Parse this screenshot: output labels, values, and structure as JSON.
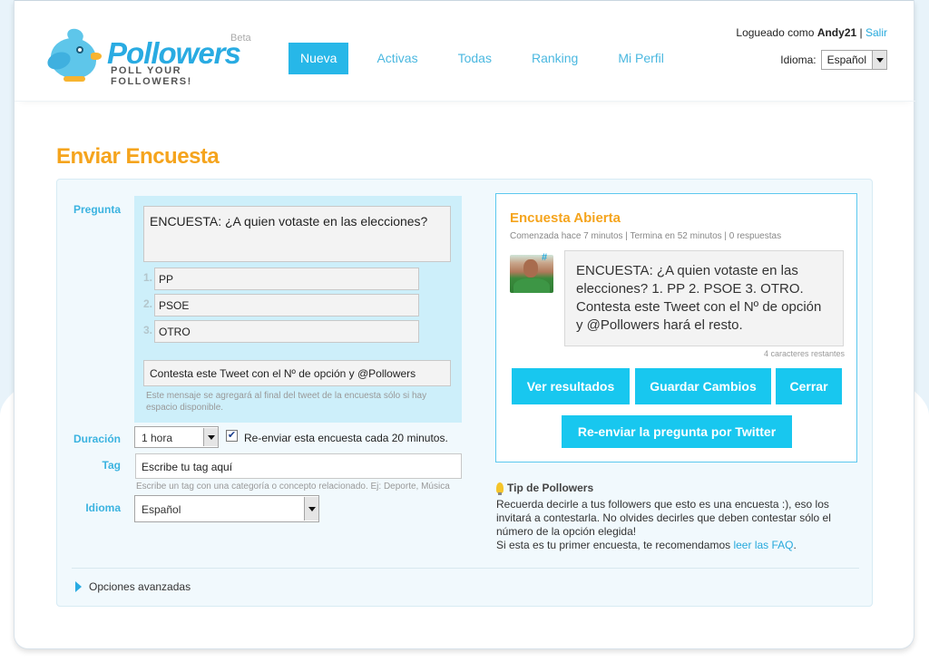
{
  "header": {
    "brand": "Pollowers",
    "beta": "Beta",
    "tagline": "POLL YOUR FOLLOWERS!",
    "nav": [
      {
        "label": "Nueva",
        "active": true
      },
      {
        "label": "Activas",
        "active": false
      },
      {
        "label": "Todas",
        "active": false
      },
      {
        "label": "Ranking",
        "active": false
      },
      {
        "label": "Mi Perfil",
        "active": false
      }
    ],
    "logged_prefix": "Logueado como",
    "username": "Andy21",
    "separator": "|",
    "logout": "Salir",
    "language_label": "Idioma:",
    "language_value": "Español"
  },
  "page_title": "Enviar Encuesta",
  "form": {
    "question_label": "Pregunta",
    "question": "ENCUESTA: ¿A quien votaste en las elecciones?",
    "options": [
      {
        "num": "1.",
        "value": "PP"
      },
      {
        "num": "2.",
        "value": "PSOE"
      },
      {
        "num": "3.",
        "value": "OTRO"
      }
    ],
    "suffix": "Contesta este Tweet con el Nº de opción y @Pollowers",
    "suffix_note": "Este mensaje se agregará al final del tweet de la encuesta sólo si hay espacio disponible.",
    "duration_label": "Duración",
    "duration_value": "1 hora",
    "resend_checked": true,
    "resend_label": "Re-enviar esta encuesta cada 20 minutos.",
    "tag_label": "Tag",
    "tag_value": "Escribe tu tag aquí",
    "tag_note": "Escribe un tag con una categoría o concepto relacionado. Ej: Deporte, Música",
    "language_label": "Idioma",
    "language_value": "Español",
    "advanced_label": "Opciones avanzadas"
  },
  "preview": {
    "title": "Encuesta Abierta",
    "meta": "Comenzada hace 7 minutos | Termina en 52 minutos | 0 respuestas",
    "hash_icon": "#",
    "tweet": "ENCUESTA: ¿A quien votaste en las elecciones? 1. PP 2. PSOE 3. OTRO. Contesta este Tweet con el Nº de opción y @Pollowers hará el resto.",
    "remaining": "4 caracteres restantes",
    "buttons": {
      "results": "Ver resultados",
      "save": "Guardar Cambios",
      "close": "Cerrar",
      "resend": "Re-enviar la pregunta por Twitter"
    }
  },
  "tip": {
    "title": "Tip de Pollowers",
    "body": "Recuerda decirle a tus followers que esto es una encuesta :), eso los invitará a contestarla. No olvides decirles que deben contestar sólo el número de la opción elegida!",
    "line2_prefix": "Si esta es tu primer encuesta, te recomendamos",
    "faq_link": "leer las FAQ",
    "line2_suffix": "."
  },
  "colors": {
    "accent": "#27b7e8",
    "button": "#18c7ef",
    "title": "#f5a41d",
    "panel": "#f1f9fd",
    "question_bg": "#cdeffa"
  }
}
